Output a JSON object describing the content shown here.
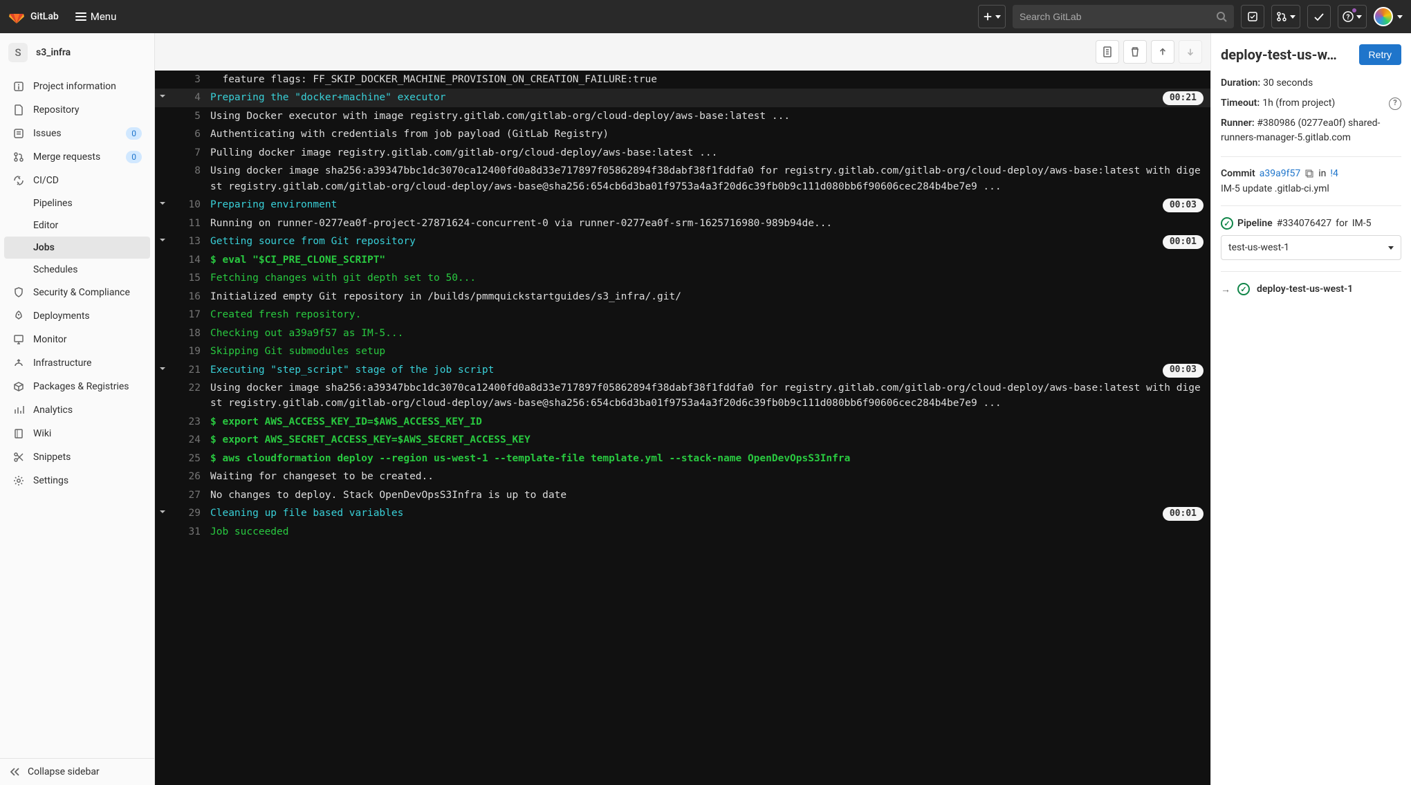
{
  "brand": "GitLab",
  "menu_label": "Menu",
  "search_placeholder": "Search GitLab",
  "project": {
    "initial": "S",
    "name": "s3_infra"
  },
  "sidebar": {
    "items": [
      {
        "icon": "info",
        "label": "Project information"
      },
      {
        "icon": "file",
        "label": "Repository"
      },
      {
        "icon": "issues",
        "label": "Issues",
        "badge": "0"
      },
      {
        "icon": "merge",
        "label": "Merge requests",
        "badge": "0"
      },
      {
        "icon": "cicd",
        "label": "CI/CD"
      },
      {
        "icon": "shield",
        "label": "Security & Compliance"
      },
      {
        "icon": "rocket",
        "label": "Deployments"
      },
      {
        "icon": "monitor",
        "label": "Monitor"
      },
      {
        "icon": "infra",
        "label": "Infrastructure"
      },
      {
        "icon": "package",
        "label": "Packages & Registries"
      },
      {
        "icon": "chart",
        "label": "Analytics"
      },
      {
        "icon": "wiki",
        "label": "Wiki"
      },
      {
        "icon": "snip",
        "label": "Snippets"
      },
      {
        "icon": "gear",
        "label": "Settings"
      }
    ],
    "cicd_subitems": [
      {
        "label": "Pipelines"
      },
      {
        "label": "Editor"
      },
      {
        "label": "Jobs",
        "active": true
      },
      {
        "label": "Schedules"
      }
    ],
    "collapse_label": "Collapse sidebar"
  },
  "detail": {
    "title": "deploy-test-us-w…",
    "retry": "Retry",
    "duration_label": "Duration:",
    "duration": "30 seconds",
    "timeout_label": "Timeout:",
    "timeout": "1h (from project)",
    "runner_label": "Runner:",
    "runner": "#380986 (0277ea0f) shared-runners-manager-5.gitlab.com",
    "commit_label": "Commit",
    "commit_sha": "a39a9f57",
    "commit_in": "in",
    "mr": "!4",
    "commit_msg": "IM-5 update .gitlab-ci.yml",
    "pipeline_label": "Pipeline",
    "pipeline_id": "#334076427",
    "pipeline_for": "for",
    "pipeline_ref": "IM-5",
    "stage_selected": "test-us-west-1",
    "job_link": "deploy-test-us-west-1"
  },
  "log": [
    {
      "n": 3,
      "caret": false,
      "cls": "",
      "text": "  feature flags: FF_SKIP_DOCKER_MACHINE_PROVISION_ON_CREATION_FAILURE:true"
    },
    {
      "n": 4,
      "caret": true,
      "cls": "c-cyan",
      "text": "Preparing the \"docker+machine\" executor",
      "time": "00:21",
      "sec": true
    },
    {
      "n": 5,
      "caret": false,
      "cls": "",
      "text": "Using Docker executor with image registry.gitlab.com/gitlab-org/cloud-deploy/aws-base:latest ..."
    },
    {
      "n": 6,
      "caret": false,
      "cls": "",
      "text": "Authenticating with credentials from job payload (GitLab Registry)"
    },
    {
      "n": 7,
      "caret": false,
      "cls": "",
      "text": "Pulling docker image registry.gitlab.com/gitlab-org/cloud-deploy/aws-base:latest ..."
    },
    {
      "n": 8,
      "caret": false,
      "cls": "",
      "text": "Using docker image sha256:a39347bbc1dc3070ca12400fd0a8d33e717897f05862894f38dabf38f1fddfa0 for registry.gitlab.com/gitlab-org/cloud-deploy/aws-base:latest with digest registry.gitlab.com/gitlab-org/cloud-deploy/aws-base@sha256:654cb6d3ba01f9753a4a3f20d6c39fb0b9c111d080bb6f90606cec284b4be7e9 ..."
    },
    {
      "n": 10,
      "caret": true,
      "cls": "c-cyan",
      "text": "Preparing environment",
      "time": "00:03"
    },
    {
      "n": 11,
      "caret": false,
      "cls": "",
      "text": "Running on runner-0277ea0f-project-27871624-concurrent-0 via runner-0277ea0f-srm-1625716980-989b94de..."
    },
    {
      "n": 13,
      "caret": true,
      "cls": "c-cyan",
      "text": "Getting source from Git repository",
      "time": "00:01"
    },
    {
      "n": 14,
      "caret": false,
      "cls": "c-greenb",
      "text": "$ eval \"$CI_PRE_CLONE_SCRIPT\""
    },
    {
      "n": 15,
      "caret": false,
      "cls": "c-green",
      "text": "Fetching changes with git depth set to 50..."
    },
    {
      "n": 16,
      "caret": false,
      "cls": "",
      "text": "Initialized empty Git repository in /builds/pmmquickstartguides/s3_infra/.git/"
    },
    {
      "n": 17,
      "caret": false,
      "cls": "c-green",
      "text": "Created fresh repository."
    },
    {
      "n": 18,
      "caret": false,
      "cls": "c-green",
      "text": "Checking out a39a9f57 as IM-5..."
    },
    {
      "n": 19,
      "caret": false,
      "cls": "c-green",
      "text": "Skipping Git submodules setup"
    },
    {
      "n": 21,
      "caret": true,
      "cls": "c-cyan",
      "text": "Executing \"step_script\" stage of the job script",
      "time": "00:03"
    },
    {
      "n": 22,
      "caret": false,
      "cls": "",
      "text": "Using docker image sha256:a39347bbc1dc3070ca12400fd0a8d33e717897f05862894f38dabf38f1fddfa0 for registry.gitlab.com/gitlab-org/cloud-deploy/aws-base:latest with digest registry.gitlab.com/gitlab-org/cloud-deploy/aws-base@sha256:654cb6d3ba01f9753a4a3f20d6c39fb0b9c111d080bb6f90606cec284b4be7e9 ..."
    },
    {
      "n": 23,
      "caret": false,
      "cls": "c-greenb",
      "text": "$ export AWS_ACCESS_KEY_ID=$AWS_ACCESS_KEY_ID"
    },
    {
      "n": 24,
      "caret": false,
      "cls": "c-greenb",
      "text": "$ export AWS_SECRET_ACCESS_KEY=$AWS_SECRET_ACCESS_KEY"
    },
    {
      "n": 25,
      "caret": false,
      "cls": "c-greenb",
      "text": "$ aws cloudformation deploy --region us-west-1 --template-file template.yml --stack-name OpenDevOpsS3Infra"
    },
    {
      "n": 26,
      "caret": false,
      "cls": "",
      "text": "Waiting for changeset to be created.."
    },
    {
      "n": 27,
      "caret": false,
      "cls": "",
      "text": "No changes to deploy. Stack OpenDevOpsS3Infra is up to date"
    },
    {
      "n": 29,
      "caret": true,
      "cls": "c-cyan",
      "text": "Cleaning up file based variables",
      "time": "00:01"
    },
    {
      "n": 31,
      "caret": false,
      "cls": "c-green",
      "text": "Job succeeded"
    }
  ]
}
